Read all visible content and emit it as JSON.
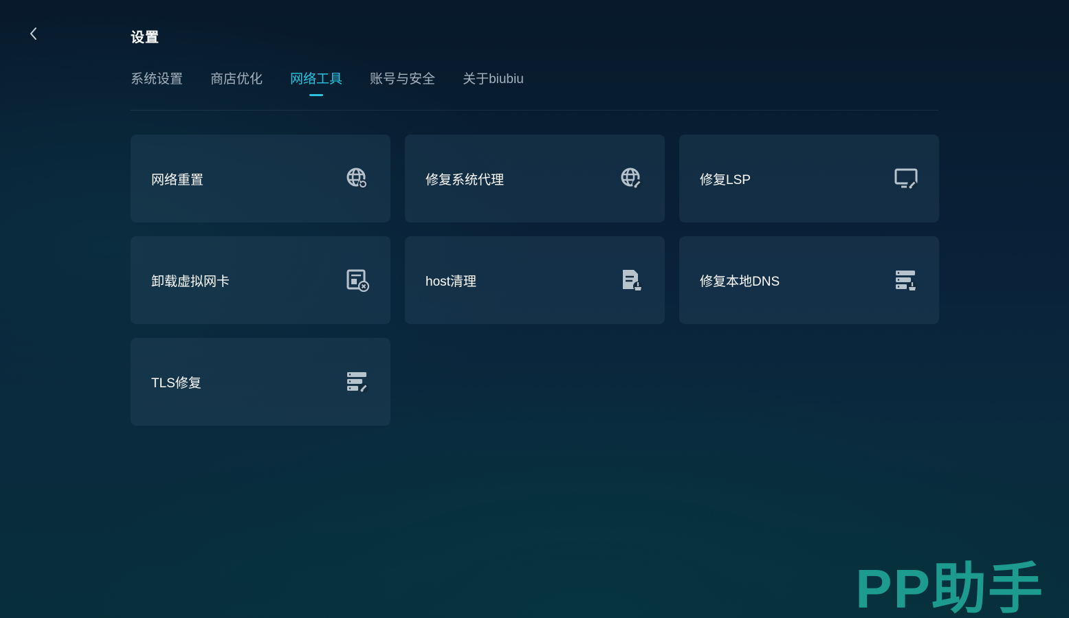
{
  "header": {
    "back_icon": "chevron-left-icon",
    "title": "设置"
  },
  "tabs": [
    {
      "label": "系统设置",
      "active": false
    },
    {
      "label": "商店优化",
      "active": false
    },
    {
      "label": "网络工具",
      "active": true
    },
    {
      "label": "账号与安全",
      "active": false
    },
    {
      "label": "关于biubiu",
      "active": false
    }
  ],
  "tools": [
    {
      "label": "网络重置",
      "icon": "globe-refresh-icon"
    },
    {
      "label": "修复系统代理",
      "icon": "globe-wrench-icon"
    },
    {
      "label": "修复LSP",
      "icon": "monitor-wrench-icon"
    },
    {
      "label": "卸载虚拟网卡",
      "icon": "network-card-remove-icon"
    },
    {
      "label": "host清理",
      "icon": "document-broom-icon"
    },
    {
      "label": "修复本地DNS",
      "icon": "server-wrench-icon"
    },
    {
      "label": "TLS修复",
      "icon": "server-wrench-icon"
    }
  ],
  "watermark": "PP助手",
  "colors": {
    "accent": "#2cc2e0",
    "watermark": "#1fa596",
    "icon": "#b7c3cd"
  }
}
